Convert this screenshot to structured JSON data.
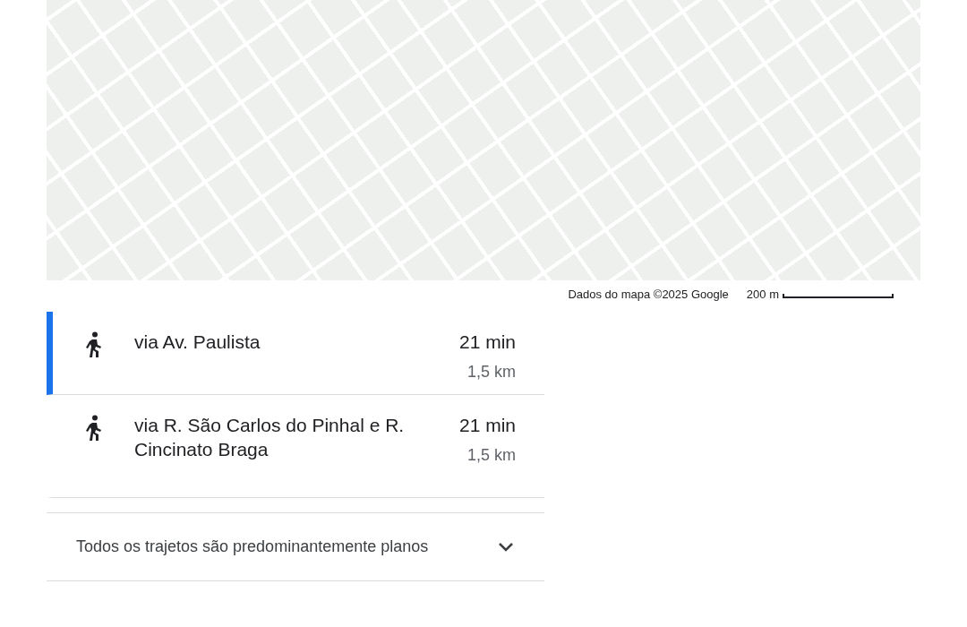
{
  "map": {
    "attribution": "Dados do mapa ©2025 Google",
    "scale": "200 m"
  },
  "routes": [
    {
      "name": "via Av. Paulista",
      "duration": "21 min",
      "distance": "1,5 km",
      "selected": true
    },
    {
      "name": "via R. São Carlos do Pinhal e R. Cincinato Braga",
      "duration": "21 min",
      "distance": "1,5 km",
      "selected": false
    }
  ],
  "footer": {
    "text": "Todos os trajetos são predominantemente planos",
    "expanded": false
  }
}
